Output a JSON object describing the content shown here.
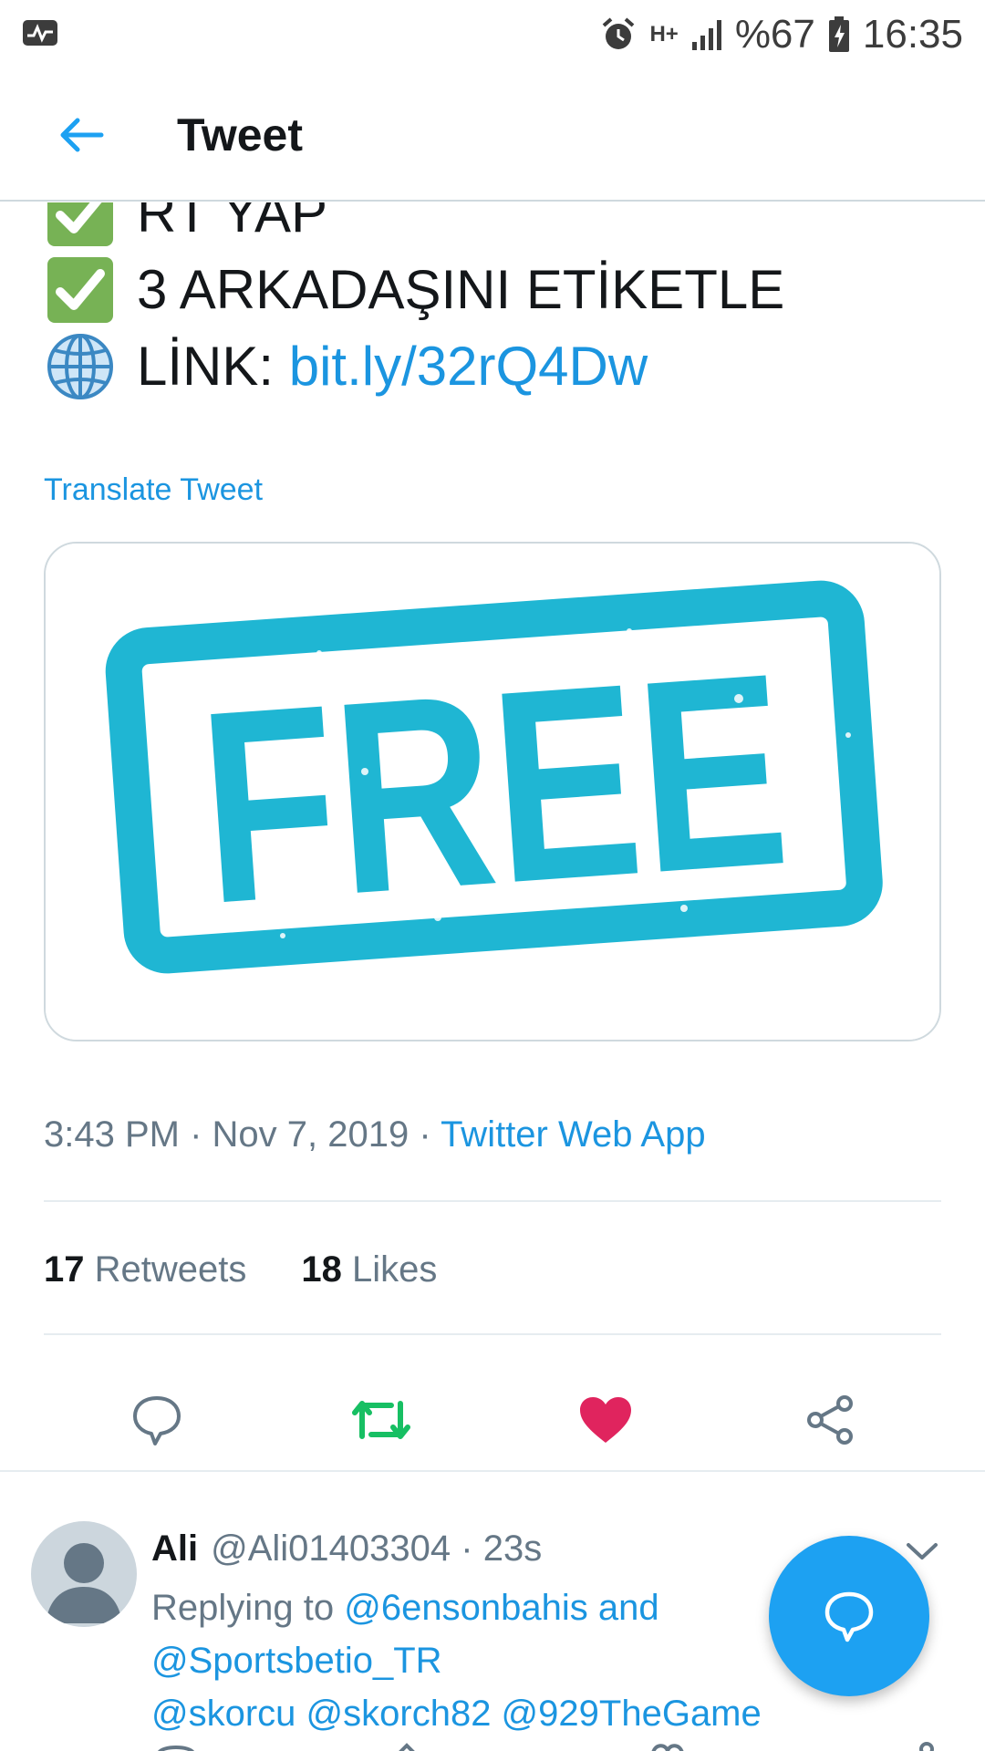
{
  "status_bar": {
    "battery": "%67",
    "time": "16:35",
    "network": "H+"
  },
  "header": {
    "title": "Tweet"
  },
  "tweet": {
    "lines": [
      {
        "icon": "check-box-emoji",
        "text": "RT YAP"
      },
      {
        "icon": "check-box-emoji",
        "text": "3 ARKADAŞINI ETİKETLE"
      },
      {
        "icon": "globe-emoji",
        "text_prefix": "LİNK: ",
        "link": "bit.ly/32rQ4Dw"
      }
    ],
    "translate_label": "Translate Tweet",
    "image_word": "FREE",
    "time": "3:43 PM",
    "date": "Nov 7, 2019",
    "source": "Twitter Web App",
    "retweets_count": "17",
    "retweets_label": "Retweets",
    "likes_count": "18",
    "likes_label": "Likes"
  },
  "reply": {
    "name": "Ali",
    "handle": "@Ali01403304",
    "time": "23s",
    "replying_prefix": "Replying to",
    "replying_mention_1": "@6ensonbahis",
    "replying_and": "and",
    "replying_mention_2": "@Sportsbetio_TR",
    "body": "@skorcu @skorch82 @929TheGame"
  },
  "colors": {
    "accent": "#1da1f2",
    "link": "#1b95e0",
    "retweet_green": "#17bf63",
    "like_red": "#e0245e",
    "stamp_cyan": "#1fb6d3"
  }
}
